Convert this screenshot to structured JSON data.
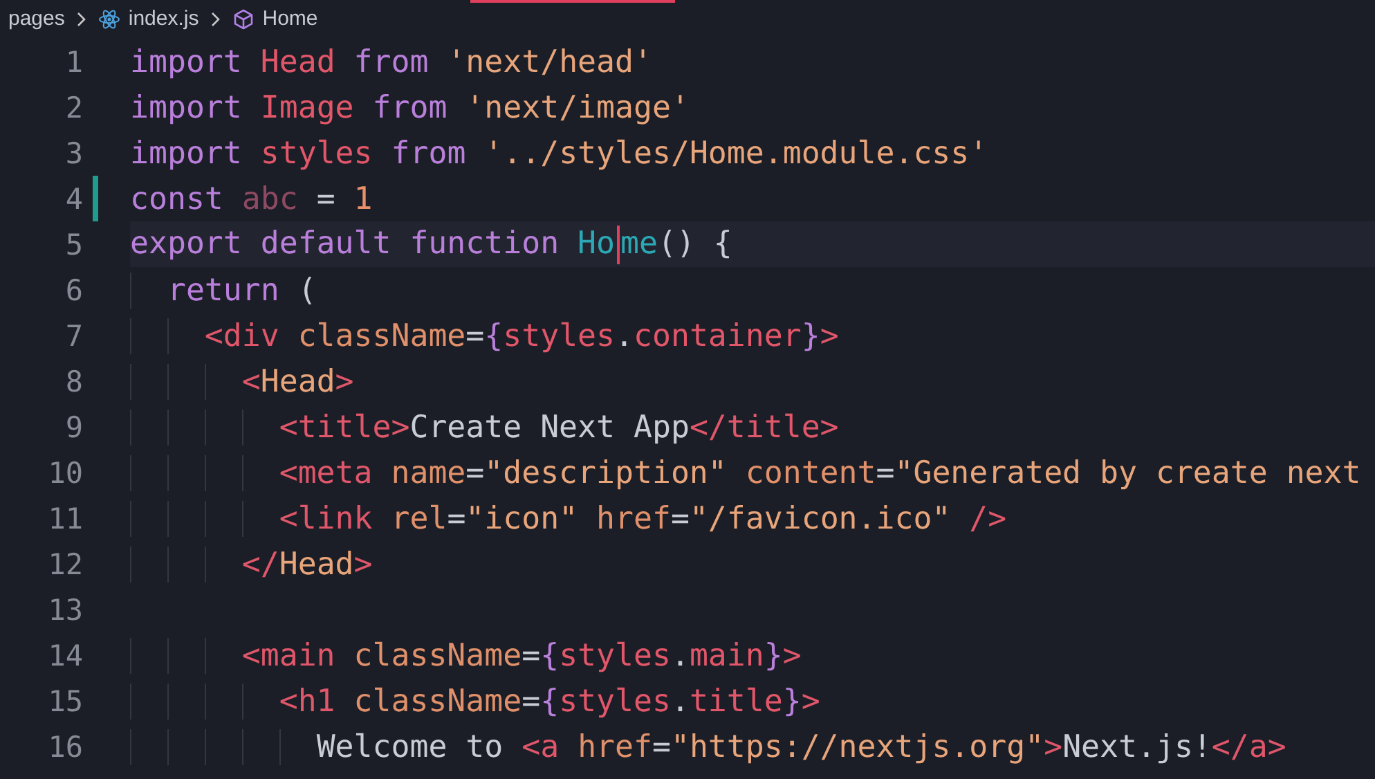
{
  "breadcrumb": [
    {
      "kind": "folder",
      "text": "pages"
    },
    {
      "kind": "file",
      "text": "index.js"
    },
    {
      "kind": "symbol",
      "text": "Home"
    }
  ],
  "lines": [
    {
      "number": "1",
      "current": false,
      "modified": false,
      "tokens": [
        {
          "text": "import ",
          "kind": "kw"
        },
        {
          "text": "Head ",
          "kind": "ident"
        },
        {
          "text": "from ",
          "kind": "kw"
        },
        {
          "text": "'next/head'",
          "kind": "str"
        }
      ]
    },
    {
      "number": "2",
      "current": false,
      "modified": false,
      "tokens": [
        {
          "text": "import ",
          "kind": "kw"
        },
        {
          "text": "Image ",
          "kind": "ident"
        },
        {
          "text": "from ",
          "kind": "kw"
        },
        {
          "text": "'next/image'",
          "kind": "str"
        }
      ]
    },
    {
      "number": "3",
      "current": false,
      "modified": false,
      "tokens": [
        {
          "text": "import ",
          "kind": "kw"
        },
        {
          "text": "styles ",
          "kind": "ident"
        },
        {
          "text": "from ",
          "kind": "kw"
        },
        {
          "text": "'../styles/Home.module.css'",
          "kind": "str"
        }
      ]
    },
    {
      "number": "4",
      "current": false,
      "modified": true,
      "tokens": [
        {
          "text": "const ",
          "kind": "kw"
        },
        {
          "text": "abc",
          "kind": "dim"
        },
        {
          "text": " = ",
          "kind": "plain"
        },
        {
          "text": "1",
          "kind": "num"
        }
      ]
    },
    {
      "number": "5",
      "current": true,
      "modified": false,
      "tokens": [
        {
          "text": "export default function ",
          "kind": "kw"
        },
        {
          "text": "Ho",
          "kind": "fn"
        },
        {
          "text": "me",
          "kind": "fn",
          "caret": true
        },
        {
          "text": "() {",
          "kind": "plain"
        }
      ]
    },
    {
      "number": "6",
      "current": false,
      "modified": false,
      "tokens": [
        {
          "text": "  return",
          "kind": "kw"
        },
        {
          "text": " (",
          "kind": "plain"
        }
      ]
    },
    {
      "number": "7",
      "current": false,
      "modified": false,
      "tokens": [
        {
          "text": "    <div ",
          "kind": "tag"
        },
        {
          "text": "className",
          "kind": "attr"
        },
        {
          "text": "=",
          "kind": "plain"
        },
        {
          "text": "{",
          "kind": "brace"
        },
        {
          "text": "styles",
          "kind": "ident"
        },
        {
          "text": ".",
          "kind": "plain"
        },
        {
          "text": "container",
          "kind": "ident"
        },
        {
          "text": "}",
          "kind": "brace"
        },
        {
          "text": ">",
          "kind": "tag"
        }
      ]
    },
    {
      "number": "8",
      "current": false,
      "modified": false,
      "tokens": [
        {
          "text": "      <",
          "kind": "tag"
        },
        {
          "text": "Head",
          "kind": "comp"
        },
        {
          "text": ">",
          "kind": "tag"
        }
      ]
    },
    {
      "number": "9",
      "current": false,
      "modified": false,
      "tokens": [
        {
          "text": "        <title>",
          "kind": "tag"
        },
        {
          "text": "Create Next App",
          "kind": "text"
        },
        {
          "text": "</title>",
          "kind": "tag"
        }
      ]
    },
    {
      "number": "10",
      "current": false,
      "modified": false,
      "tokens": [
        {
          "text": "        <meta ",
          "kind": "tag"
        },
        {
          "text": "name",
          "kind": "attr"
        },
        {
          "text": "=",
          "kind": "plain"
        },
        {
          "text": "\"description\" ",
          "kind": "str"
        },
        {
          "text": "content",
          "kind": "attr"
        },
        {
          "text": "=",
          "kind": "plain"
        },
        {
          "text": "\"Generated by create next",
          "kind": "str"
        }
      ]
    },
    {
      "number": "11",
      "current": false,
      "modified": false,
      "tokens": [
        {
          "text": "        <link ",
          "kind": "tag"
        },
        {
          "text": "rel",
          "kind": "attr"
        },
        {
          "text": "=",
          "kind": "plain"
        },
        {
          "text": "\"icon\" ",
          "kind": "str"
        },
        {
          "text": "href",
          "kind": "attr"
        },
        {
          "text": "=",
          "kind": "plain"
        },
        {
          "text": "\"/favicon.ico\" ",
          "kind": "str"
        },
        {
          "text": "/>",
          "kind": "tag"
        }
      ]
    },
    {
      "number": "12",
      "current": false,
      "modified": false,
      "tokens": [
        {
          "text": "      </",
          "kind": "tag"
        },
        {
          "text": "Head",
          "kind": "comp"
        },
        {
          "text": ">",
          "kind": "tag"
        }
      ]
    },
    {
      "number": "13",
      "current": false,
      "modified": false
    },
    {
      "number": "14",
      "current": false,
      "modified": false,
      "tokens": [
        {
          "text": "      <main ",
          "kind": "tag"
        },
        {
          "text": "className",
          "kind": "attr"
        },
        {
          "text": "=",
          "kind": "plain"
        },
        {
          "text": "{",
          "kind": "brace"
        },
        {
          "text": "styles",
          "kind": "ident"
        },
        {
          "text": ".",
          "kind": "plain"
        },
        {
          "text": "main",
          "kind": "ident"
        },
        {
          "text": "}",
          "kind": "brace"
        },
        {
          "text": ">",
          "kind": "tag"
        }
      ]
    },
    {
      "number": "15",
      "current": false,
      "modified": false,
      "tokens": [
        {
          "text": "        <h1 ",
          "kind": "tag"
        },
        {
          "text": "className",
          "kind": "attr"
        },
        {
          "text": "=",
          "kind": "plain"
        },
        {
          "text": "{",
          "kind": "brace"
        },
        {
          "text": "styles",
          "kind": "ident"
        },
        {
          "text": ".",
          "kind": "plain"
        },
        {
          "text": "title",
          "kind": "ident"
        },
        {
          "text": "}",
          "kind": "brace"
        },
        {
          "text": ">",
          "kind": "tag"
        }
      ]
    },
    {
      "number": "16",
      "current": false,
      "modified": false,
      "tokens": [
        {
          "text": "          Welcome to ",
          "kind": "text"
        },
        {
          "text": "<a ",
          "kind": "tag"
        },
        {
          "text": "href",
          "kind": "attr"
        },
        {
          "text": "=",
          "kind": "plain"
        },
        {
          "text": "\"https://nextjs.org\"",
          "kind": "str"
        },
        {
          "text": ">",
          "kind": "tag"
        },
        {
          "text": "Next.js!",
          "kind": "text"
        },
        {
          "text": "</a>",
          "kind": "tag"
        }
      ]
    }
  ]
}
